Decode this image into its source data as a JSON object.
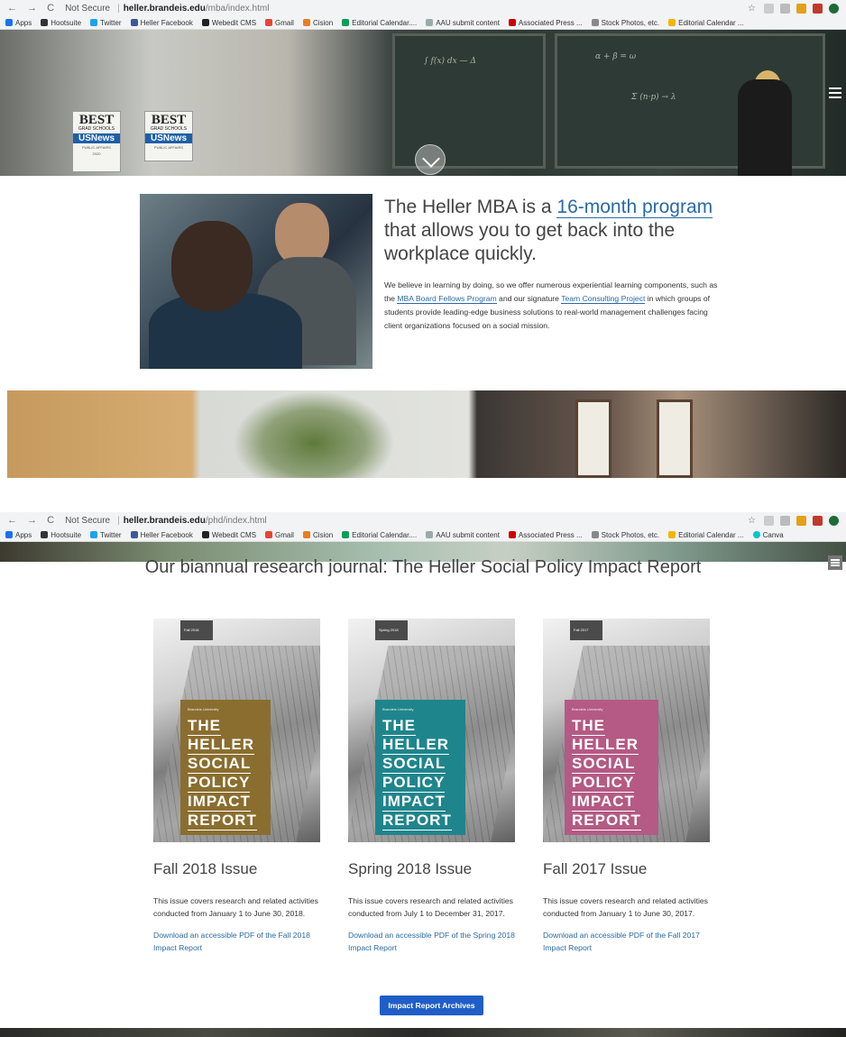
{
  "browser1": {
    "security": "Not Secure",
    "host": "heller.brandeis.edu",
    "path": "/mba/index.html",
    "bookmarks": [
      "Apps",
      "Hootsuite",
      "Twitter",
      "Heller Facebook",
      "Webedit CMS",
      "Gmail",
      "Cision",
      "Editorial Calendar....",
      "AAU submit content",
      "Associated Press ...",
      "Stock Photos, etc.",
      "Editorial Calendar ..."
    ]
  },
  "hero": {
    "badge1": {
      "best": "BEST",
      "grad": "GRAD SCHOOLS",
      "brand": "USNews",
      "sub": "PUBLIC AFFAIRS",
      "year": "2020"
    },
    "badge2": {
      "best": "BEST",
      "grad": "GRAD SCHOOLS",
      "brand": "USNews",
      "sub": "PUBLIC AFFAIRS"
    }
  },
  "intro": {
    "heading_pre": "The Heller MBA is a ",
    "heading_link": "16-month program",
    "heading_post": " that allows you to get back into the workplace quickly.",
    "body_1": "We believe in learning by doing, so we offer numerous experiential learning components, such as the ",
    "body_link1": "MBA Board Fellows Program",
    "body_2": " and our signature ",
    "body_link2": "Team Consulting Project",
    "body_3": " in which groups of students provide leading-edge business solutions to real-world management challenges facing client organizations focused on a social mission."
  },
  "browser2": {
    "security": "Not Secure",
    "host": "heller.brandeis.edu",
    "path": "/phd/index.html",
    "bookmarks": [
      "Apps",
      "Hootsuite",
      "Twitter",
      "Heller Facebook",
      "Webedit CMS",
      "Gmail",
      "Cision",
      "Editorial Calendar....",
      "AAU submit content",
      "Associated Press ...",
      "Stock Photos, etc.",
      "Editorial Calendar ...",
      "Canva"
    ]
  },
  "journal": {
    "title": "Our biannual research journal: The Heller Social Policy Impact Report",
    "issues": [
      {
        "tag": "Fall 2018",
        "uni": "Brandeis University",
        "cover_lines": [
          "THE",
          "HELLER",
          "SOCIAL",
          "POLICY",
          "IMPACT",
          "REPORT"
        ],
        "color": "#8a6e2f",
        "title": "Fall 2018 Issue",
        "desc": "This issue covers research and related activities conducted from January 1 to June 30, 2018.",
        "link": "Download an accessible PDF of the Fall 2018 Impact Report"
      },
      {
        "tag": "Spring 2018",
        "uni": "Brandeis University",
        "cover_lines": [
          "THE",
          "HELLER",
          "SOCIAL",
          "POLICY",
          "IMPACT",
          "REPORT"
        ],
        "color": "#1f858c",
        "title": "Spring 2018 Issue",
        "desc": "This issue covers research and related activities conducted from July 1 to December 31, 2017.",
        "link": "Download an accessible PDF of the Spring 2018 Impact Report"
      },
      {
        "tag": "Fall 2017",
        "uni": "Brandeis University",
        "cover_lines": [
          "THE",
          "HELLER",
          "SOCIAL",
          "POLICY",
          "IMPACT",
          "REPORT"
        ],
        "color": "#b45a84",
        "title": "Fall 2017 Issue",
        "desc": "This issue covers research and related activities conducted from January 1 to June 30, 2017.",
        "link": "Download an accessible PDF of the Fall 2017 Impact Report"
      }
    ],
    "archives_button": "Impact Report Archives"
  }
}
